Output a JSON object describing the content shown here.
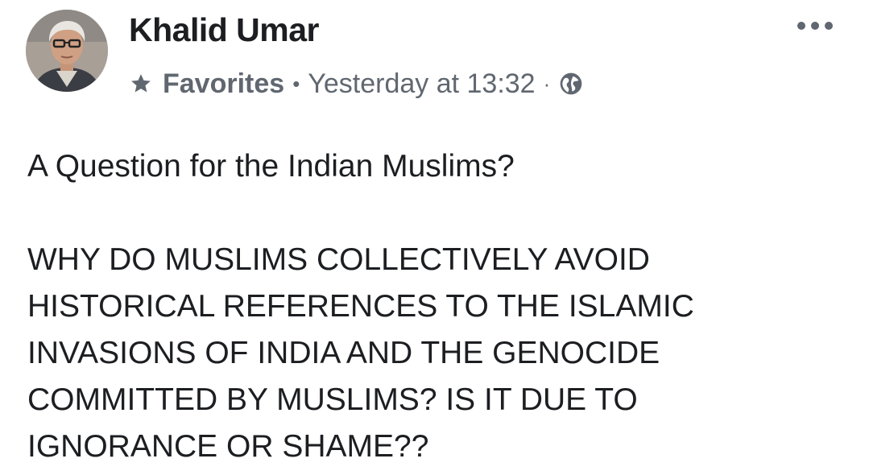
{
  "post": {
    "author_name": "Khalid Umar",
    "audience_label": "Favorites",
    "separator": "•",
    "timestamp": "Yesterday at 13:32",
    "timestamp_separator": "·",
    "privacy_icon": "globe-icon",
    "audience_icon": "star-icon",
    "more_icon": "more-options-icon",
    "body_intro": "A Question for the Indian Muslims?",
    "body_lines": [
      "WHY DO MUSLIMS COLLECTIVELY AVOID",
      "HISTORICAL REFERENCES TO THE ISLAMIC",
      "INVASIONS OF INDIA AND THE GENOCIDE",
      "COMMITTED BY MUSLIMS? IS IT DUE TO",
      "IGNORANCE OR SHAME??"
    ]
  },
  "colors": {
    "text_primary": "#1c1e21",
    "text_secondary": "#606770",
    "background": "#ffffff"
  }
}
